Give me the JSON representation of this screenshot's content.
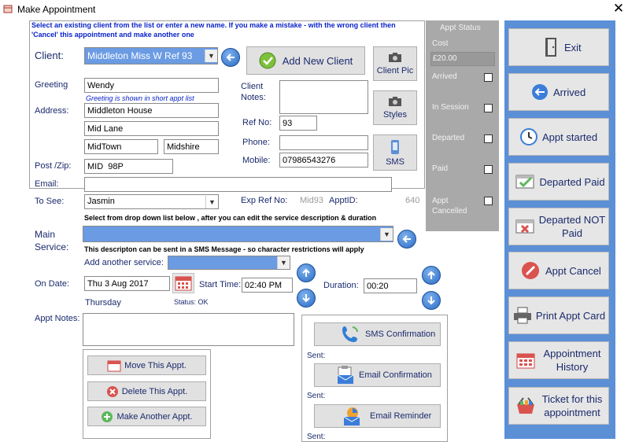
{
  "window": {
    "title": "Make Appointment"
  },
  "hint_top": "Select an existing client from the list or enter a new name. If you make a mistake - with the wrong client then 'Cancel' this appointment and make another one",
  "client": {
    "label": "Client:",
    "value": "Middleton  Miss  W Ref 93",
    "add_new_label": "Add New Client",
    "client_pic_label": "Client Pic",
    "styles_label": "Styles",
    "sms_label": "SMS"
  },
  "greeting": {
    "label": "Greeting",
    "value": "Wendy",
    "note": "Greeting is shown in short appt list"
  },
  "address": {
    "label": "Address:",
    "line1": "Middleton House",
    "line2": "Mid Lane",
    "town": "MidTown",
    "county": "Midshire"
  },
  "postzip": {
    "label": "Post /Zip:",
    "value": "MID  98P"
  },
  "email": {
    "label": "Email:",
    "value": ""
  },
  "tosee": {
    "label": "To See:",
    "value": "Jasmin"
  },
  "client_notes": {
    "label": "Client Notes:",
    "value": ""
  },
  "refno": {
    "label": "Ref No:",
    "value": "93"
  },
  "phone": {
    "label": "Phone:",
    "value": ""
  },
  "mobile": {
    "label": "Mobile:",
    "value": "07986543276"
  },
  "exp_ref": {
    "label": "Exp Ref No:",
    "value": "Mid93"
  },
  "appt_id": {
    "label": "ApptID:",
    "value": "640"
  },
  "status": {
    "title": "Appt Status",
    "cost_label": "Cost",
    "cost_value": "£20.00",
    "arrived": "Arrived",
    "in_session": "In Session",
    "departed": "Departed",
    "paid": "Paid",
    "appt_cancelled": "Appt Cancelled"
  },
  "service": {
    "hint": "Select from drop down list below , after you can edit the service description & duration",
    "label": "Main Service:",
    "value": "",
    "sms_hint": "This descripton can be sent in a SMS Message - so character restrictions will apply",
    "add_another_label": "Add another service:"
  },
  "date": {
    "label": "On Date:",
    "value": "Thu 3 Aug 2017",
    "day": "Thursday",
    "status": "Status: OK"
  },
  "start_time": {
    "label": "Start Time:",
    "value": "02:40 PM"
  },
  "duration": {
    "label": "Duration:",
    "value": "00:20"
  },
  "appt_notes": {
    "label": "Appt Notes:",
    "value": ""
  },
  "actions": {
    "move": "Move This Appt.",
    "delete": "Delete This Appt.",
    "make_another": "Make Another Appt."
  },
  "confirmations": {
    "sms": "SMS Confirmation",
    "email": "Email Confirmation",
    "reminder": "Email Reminder",
    "sent_label": "Sent:"
  },
  "sidebar": {
    "exit": "Exit",
    "arrived": "Arrived",
    "appt_started": "Appt started",
    "departed_paid": "Departed Paid",
    "departed_not_paid": "Departed NOT Paid",
    "appt_cancel": "Appt Cancel",
    "print_card": "Print Appt Card",
    "history": "Appointment History",
    "ticket": "Ticket for this appointment"
  },
  "colors": {
    "accent_blue": "#5b8fd6",
    "status_gray": "#a9a9a9",
    "label_navy": "#1a2a6c",
    "selection_blue": "#6b9be3"
  }
}
